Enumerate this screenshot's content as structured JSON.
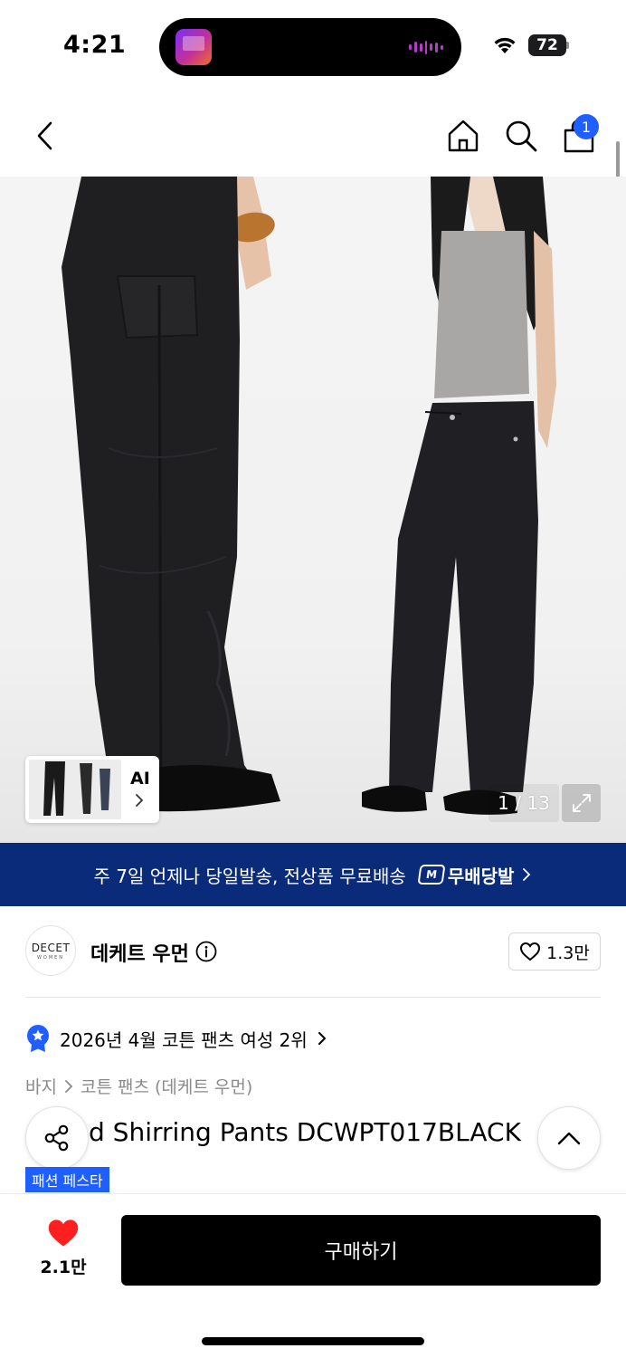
{
  "status_bar": {
    "time": "4:21",
    "battery": "72"
  },
  "nav": {
    "cart_count": "1"
  },
  "gallery": {
    "ai_label": "AI",
    "counter": "1 / 13"
  },
  "banner": {
    "text": "주 7일 언제나 당일발송, 전상품 무료배송",
    "logo_mark": "M",
    "logo_text": "무배당발"
  },
  "brand": {
    "logo_main": "DECET",
    "logo_sub": "WOMEN",
    "name": "데케트 우먼",
    "likes": "1.3만"
  },
  "ranking": {
    "text": "2026년 4월 코튼 팬츠 여성 2위"
  },
  "breadcrumb": {
    "category": "바지",
    "subcategory": "코튼 팬츠 (데케트 우먼)"
  },
  "product": {
    "title": "d Shirring Pants DCWPT017BLACK",
    "badge": "패션 페스타"
  },
  "bottom": {
    "wish_count": "2.1만",
    "buy_label": "구매하기"
  },
  "colors": {
    "accent": "#1f5eff",
    "banner_bg": "#0a2a7a",
    "heart": "#ff1f1f"
  },
  "icons": [
    "back-icon",
    "home-icon",
    "search-icon",
    "cart-icon",
    "expand-icon",
    "info-icon",
    "heart-outline-icon",
    "ranking-medal-icon",
    "share-icon",
    "chevron-up-icon",
    "heart-filled-icon"
  ]
}
